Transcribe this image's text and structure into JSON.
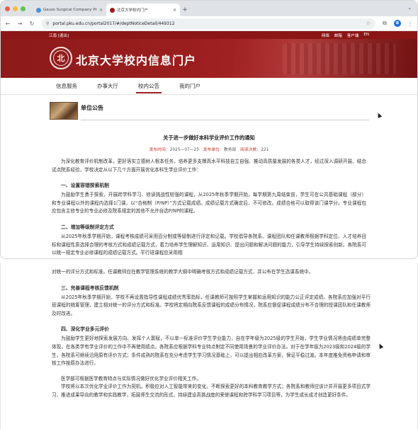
{
  "browser": {
    "tabs": [
      {
        "label": "Gauss Surgical Company Pr...",
        "active": false
      },
      {
        "label": "北京大学校内门户",
        "active": true
      }
    ],
    "url": "portal.pku.edu.cn/portal2017/#/deptNoticeDetail/449312",
    "extension_badge": "B"
  },
  "site": {
    "user": "江南 [退出]",
    "top_links": [
      "网络",
      "邮箱",
      "客户端",
      "EN"
    ],
    "portal_title": "北京大学校内信息门户",
    "logo_glyph": "北",
    "nav": [
      {
        "label": "信息服务",
        "active": false
      },
      {
        "label": "办事大厅",
        "active": false
      },
      {
        "label": "校内公告",
        "active": true
      },
      {
        "label": "我的门户",
        "active": false
      }
    ],
    "section_title": "单位公告"
  },
  "article": {
    "title": "关于进一步做好本科学业评价工作的通知",
    "meta": {
      "time_label": "发布时间:",
      "time_value": "2025—07—25",
      "unit_label": "发布单位:",
      "unit_value": "教务部",
      "views_label": "阅读次数:",
      "views_value": "221"
    },
    "intro": "为深化教育评价机制改革，更好落实立德树人根本任务，培养更多支撑高水平科技自立自强、推动高质量发展的各类人才，经过深入调研开展、结合试点院系经验，学校决定从以下几个方面开展优化本科生学业评价工作：",
    "section1": {
      "heading": "一、设置容错探索机制",
      "body": "为鼓励学生勇于探索，开展跨学科学习、修读挑战性较强的课程，从2025年秋季学期开始，每学期第九周结束前，学生可在公共基础课程（部分）和专业课程以外的课程内选择1门课，以“合格制（P/NP）”方式记载成绩。成绩记载方式确定后，不可修改。成绩合格可以取得该门课学分。专业课程包应包含主修专业的专业必修及院系规定的其他不允许自选P/NP的课程。"
    },
    "section2": {
      "heading": "二、增加等级制评定方式",
      "body_a": "从2025年秋季学期开始，课程考核成绩可采用百分制或等级制进行评定和记载。学校倡导各院系、课程团队和任课教师根据学科定位、人才培养目标和课程性质选择合理的考核方式和成绩记载方式，着力培养学生理解知识、运用知识、提出问题和解决问题的能力，引导学生持续探索创新。各院系可以统一规定专业必修课程的成绩记载方式。平行班课程应采用相",
      "body_b": "对统一的评分方式和标准。任课教师应在教学管理系统的教学大纲中明确考核方式和成绩记载方式，并公布在学生选课系统中。"
    },
    "section3": {
      "heading": "三、完善课程考核反馈机制",
      "body": "从2025年秋季学期开始，学校不再设置指导性课程成绩优秀率指标，任课教师可按照学生掌握和运用知识的能力公正评定成绩。各院系应加强对平行班课程的统筹管理，建立相对统一的评分方式和标准。学校将定期向院系反馈课程的成绩分布情况，院系应督促课程成绩分布不合理的授课团队和任课教师及时改进。"
    },
    "section4": {
      "heading": "四、深化学业多元评价",
      "body": "为鼓励学生更好地探索发展方向、发挥个人禀赋，不以单一标准评价学生学业能力，自在学年级为2025级的学生开始，学生学业情况将由成绩单完整体现，在各类学有学业评价的工作中不再使用绩点。各院系应根据学科专业特点制定不同使用场景的学业评价办法。对于在学年级为2023级和2024级的学生，各院系可继续沿用原有评价方式；条件成熟的院系在充分考虑学生学习情况基础上，可以提出相应改革方案，保证平稳过渡。本年度推免资格申请和审核工作按原办法进行。"
    },
    "closing1": "医学部可根据医学教育特点与实际情况做好优化学业评价相关工作。",
    "closing2": "学校将以本次优化学业评价工作为契机，积极应对人工智能带来的变化，不断探索更好的本科教育教学方式；各院系和教师应该计并开展更多项目式学习、推进成果导向的教学和实践教学，拓展师生交流的形式，持续建设高挑战度的荣誉课程和跨学科学习项目等，为学生成长成才创造更好条件。"
  },
  "colors": {
    "brand_red": "#8c1515",
    "meta_red": "#c0392b",
    "nav_underline": "#a32020"
  }
}
